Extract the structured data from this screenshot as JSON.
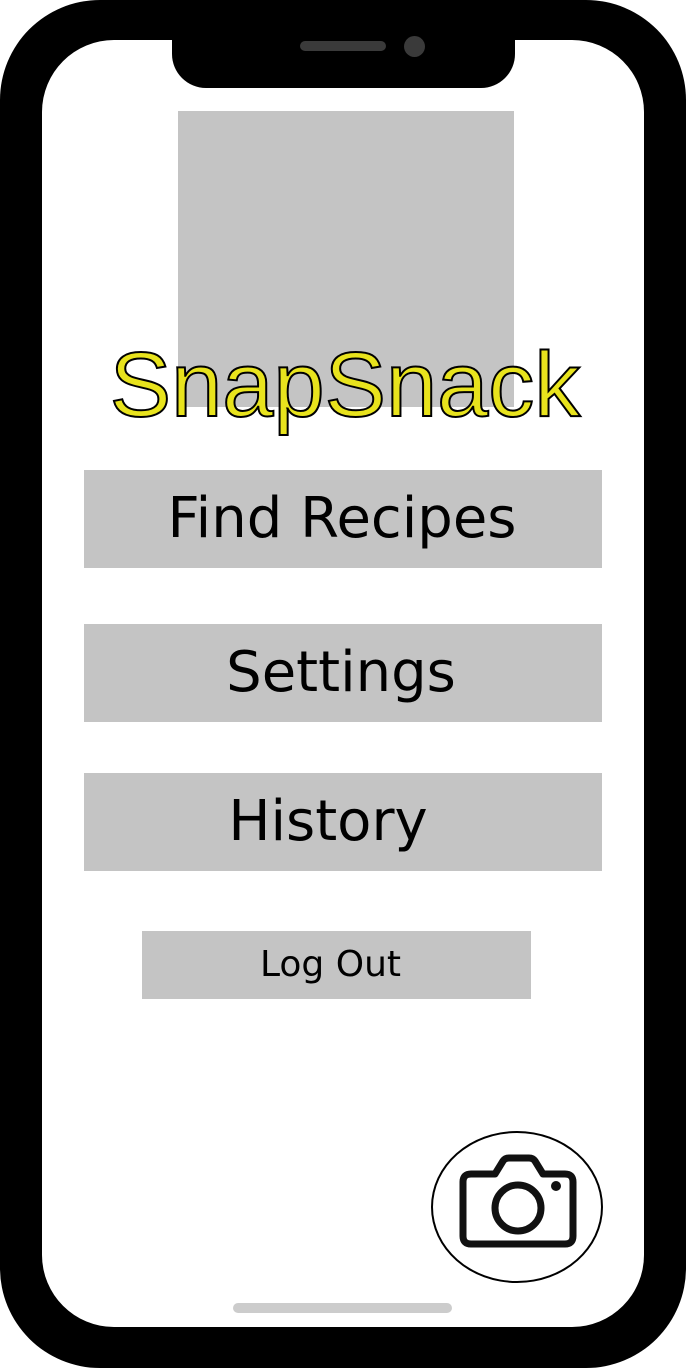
{
  "app": {
    "title": "SnapSnack"
  },
  "menu": {
    "find_recipes_label": "Find Recipes",
    "settings_label": "Settings",
    "history_label": "History",
    "logout_label": "Log Out"
  },
  "icons": {
    "logo_placeholder": "image-placeholder",
    "camera": "camera-icon"
  },
  "colors": {
    "title": "#e8e31d",
    "button_bg": "#c4c4c4",
    "frame": "#000000",
    "screen": "#ffffff"
  }
}
